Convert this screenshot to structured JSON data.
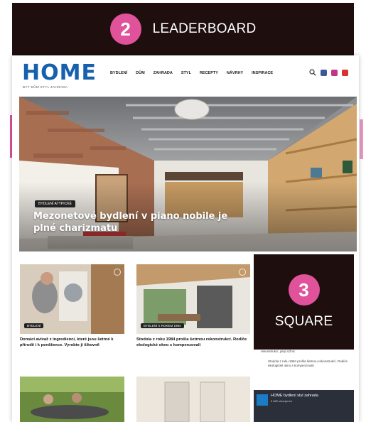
{
  "leaderboard": {
    "number": "2",
    "label": "LEADERBOARD"
  },
  "square_ad": {
    "number": "3",
    "label": "SQUARE"
  },
  "header": {
    "logo": "HOME",
    "tagline": "BYT DŮM STYL ZAHRADA",
    "nav": [
      "BYDLENÍ",
      "DŮM",
      "ZAHRADA",
      "STYL",
      "RECEPTY",
      "NÁVRHY",
      "INSPIRACE"
    ]
  },
  "hero": {
    "badge": "BYDLENÍ ATYPICKÉ",
    "title": "Mezonetové bydlení v piano nobile je plné charizmatu"
  },
  "cards": [
    {
      "badge": "BYDLENÍ",
      "title": "Domácí avívaž z ingrediencí, které jsou šetrné k přírodě i k peněžence. Vyrobte ji šikovně"
    },
    {
      "badge": "BYDLENÍ S ROKEM 1984",
      "title": "Stodola z roku 1984 prošla šetrnou rekonstrukcí. Rodiče ekologické okno s kompenzovali"
    },
    {
      "badge": "",
      "title": ""
    },
    {
      "badge": "",
      "title": ""
    }
  ],
  "sidebar": {
    "line1": "rekonstrukcí, plný ložnic",
    "line2": "Stodola z roku 1984 prošla šetrnou rekonstrukcí. Rodiče ekologické okno s kompenzovali",
    "fb_name": "HOME bydlení styl zahrada",
    "fb_sub": "5 682 sledujících"
  },
  "colors": {
    "accent": "#e0529a",
    "logo": "#1660ad",
    "ad_bg": "#1e0e0e"
  }
}
